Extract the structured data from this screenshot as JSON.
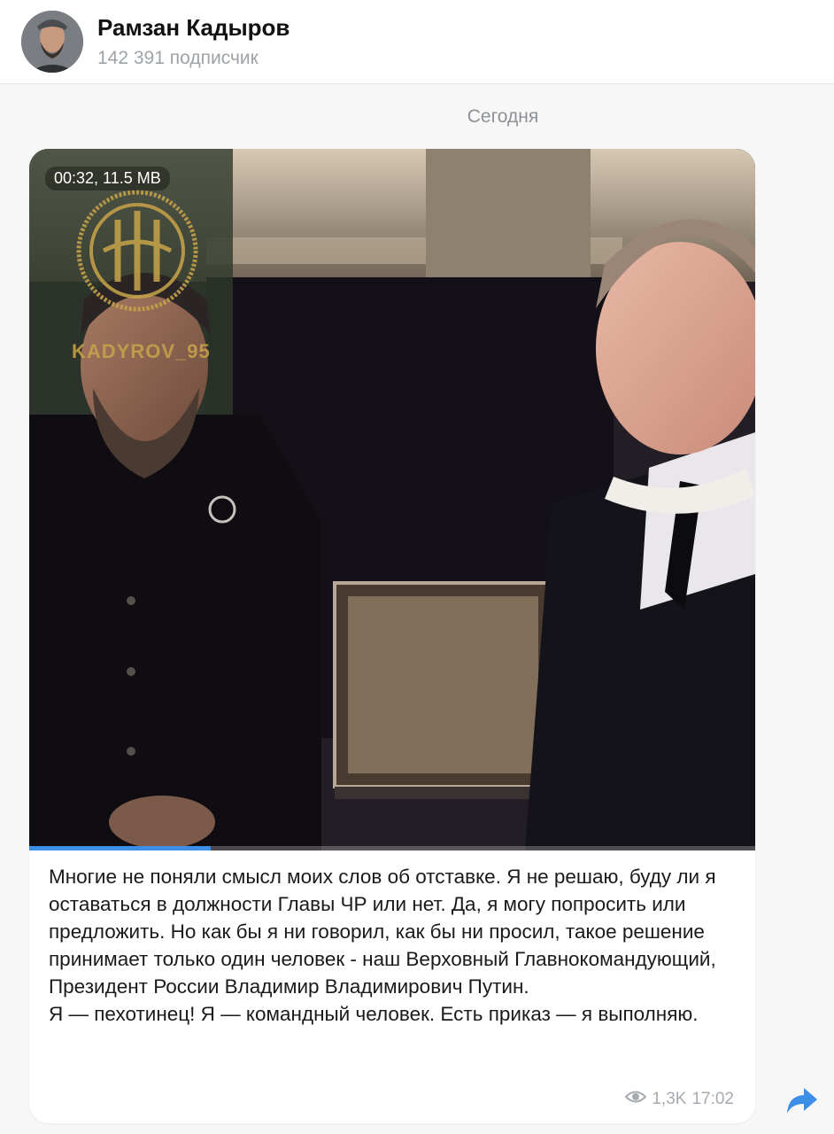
{
  "header": {
    "channel_name": "Рамзан Кадыров",
    "subscribers": "142 391 подписчик"
  },
  "chat": {
    "date_separator": "Сегодня"
  },
  "post": {
    "video": {
      "badge": "00:32, 11.5 MB",
      "watermark_text": "KADYROV_95",
      "progress": 0.25
    },
    "text": "Многие не поняли смысл моих слов об отставке. Я не решаю, буду ли я оставаться в должности Главы ЧР или нет. Да, я могу попросить или предложить. Но как бы я ни говорил, как бы ни просил, такое решение принимает только один человек - наш Верховный Главнокомандующий, Президент России Владимир Владимирович Путин.\nЯ — пехотинец! Я — командный человек. Есть приказ — я выполняю.",
    "views": "1,3K",
    "time": "17:02"
  },
  "colors": {
    "accent": "#3c8ee6",
    "meta": "#a6abb0",
    "background": "#f7f7f8"
  },
  "icons": [
    "avatar",
    "eye-icon",
    "share-arrow-icon"
  ]
}
